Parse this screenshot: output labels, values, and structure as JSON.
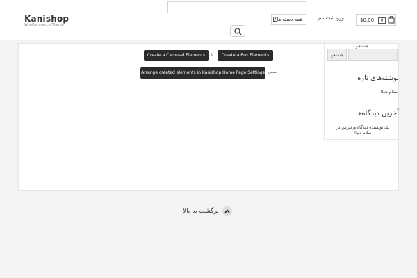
{
  "header": {
    "logo_title": "Kanishop",
    "logo_subtitle": "WooCommerce Theme",
    "category_select": "همه دسته ها",
    "login_register": "ورود ثبت نام",
    "cart": {
      "price": "$0.00",
      "count": "0"
    }
  },
  "content": {
    "btn_carousel": "Create a Carousel Elements",
    "word_or": "یا",
    "btn_box": "Create a Box Elements",
    "btn_arrange": "Arrange created elements in Kanishop Home Page Settings",
    "word_then": "سپس"
  },
  "sidebar": {
    "search_label": "جستجو",
    "search_button": "جستجو",
    "recent_posts_title": "نوشته‌های تازه",
    "recent_posts": [
      "سلام دنیا!"
    ],
    "recent_comments_title": "آخرین دیدگاه‌ها",
    "recent_comments": [
      "یک نویسنده دیدگاه وردپرس در سلام دنیا!"
    ]
  },
  "footer": {
    "back_to_top": "برگشت به بالا"
  },
  "colors": {
    "dark_button": "#2b2b2b",
    "page_background": "#f3f3f3"
  }
}
